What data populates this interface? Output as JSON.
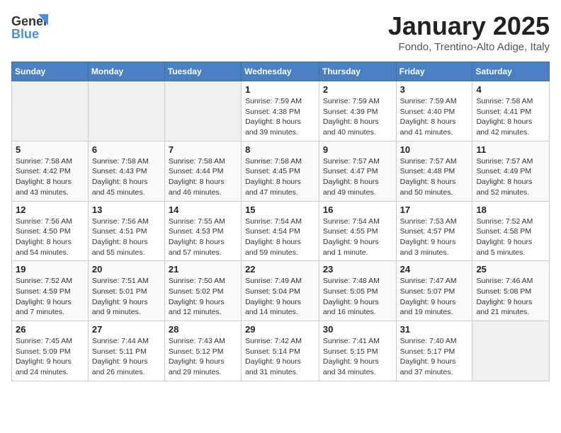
{
  "header": {
    "logo": {
      "line1": "General",
      "line2": "Blue"
    },
    "title": "January 2025",
    "subtitle": "Fondo, Trentino-Alto Adige, Italy"
  },
  "days": [
    "Sunday",
    "Monday",
    "Tuesday",
    "Wednesday",
    "Thursday",
    "Friday",
    "Saturday"
  ],
  "weeks": [
    [
      {
        "date": "",
        "sunrise": "",
        "sunset": "",
        "daylight": ""
      },
      {
        "date": "",
        "sunrise": "",
        "sunset": "",
        "daylight": ""
      },
      {
        "date": "",
        "sunrise": "",
        "sunset": "",
        "daylight": ""
      },
      {
        "date": "1",
        "sunrise": "Sunrise: 7:59 AM",
        "sunset": "Sunset: 4:38 PM",
        "daylight": "Daylight: 8 hours and 39 minutes."
      },
      {
        "date": "2",
        "sunrise": "Sunrise: 7:59 AM",
        "sunset": "Sunset: 4:39 PM",
        "daylight": "Daylight: 8 hours and 40 minutes."
      },
      {
        "date": "3",
        "sunrise": "Sunrise: 7:59 AM",
        "sunset": "Sunset: 4:40 PM",
        "daylight": "Daylight: 8 hours and 41 minutes."
      },
      {
        "date": "4",
        "sunrise": "Sunrise: 7:58 AM",
        "sunset": "Sunset: 4:41 PM",
        "daylight": "Daylight: 8 hours and 42 minutes."
      }
    ],
    [
      {
        "date": "5",
        "sunrise": "Sunrise: 7:58 AM",
        "sunset": "Sunset: 4:42 PM",
        "daylight": "Daylight: 8 hours and 43 minutes."
      },
      {
        "date": "6",
        "sunrise": "Sunrise: 7:58 AM",
        "sunset": "Sunset: 4:43 PM",
        "daylight": "Daylight: 8 hours and 45 minutes."
      },
      {
        "date": "7",
        "sunrise": "Sunrise: 7:58 AM",
        "sunset": "Sunset: 4:44 PM",
        "daylight": "Daylight: 8 hours and 46 minutes."
      },
      {
        "date": "8",
        "sunrise": "Sunrise: 7:58 AM",
        "sunset": "Sunset: 4:45 PM",
        "daylight": "Daylight: 8 hours and 47 minutes."
      },
      {
        "date": "9",
        "sunrise": "Sunrise: 7:57 AM",
        "sunset": "Sunset: 4:47 PM",
        "daylight": "Daylight: 8 hours and 49 minutes."
      },
      {
        "date": "10",
        "sunrise": "Sunrise: 7:57 AM",
        "sunset": "Sunset: 4:48 PM",
        "daylight": "Daylight: 8 hours and 50 minutes."
      },
      {
        "date": "11",
        "sunrise": "Sunrise: 7:57 AM",
        "sunset": "Sunset: 4:49 PM",
        "daylight": "Daylight: 8 hours and 52 minutes."
      }
    ],
    [
      {
        "date": "12",
        "sunrise": "Sunrise: 7:56 AM",
        "sunset": "Sunset: 4:50 PM",
        "daylight": "Daylight: 8 hours and 54 minutes."
      },
      {
        "date": "13",
        "sunrise": "Sunrise: 7:56 AM",
        "sunset": "Sunset: 4:51 PM",
        "daylight": "Daylight: 8 hours and 55 minutes."
      },
      {
        "date": "14",
        "sunrise": "Sunrise: 7:55 AM",
        "sunset": "Sunset: 4:53 PM",
        "daylight": "Daylight: 8 hours and 57 minutes."
      },
      {
        "date": "15",
        "sunrise": "Sunrise: 7:54 AM",
        "sunset": "Sunset: 4:54 PM",
        "daylight": "Daylight: 8 hours and 59 minutes."
      },
      {
        "date": "16",
        "sunrise": "Sunrise: 7:54 AM",
        "sunset": "Sunset: 4:55 PM",
        "daylight": "Daylight: 9 hours and 1 minute."
      },
      {
        "date": "17",
        "sunrise": "Sunrise: 7:53 AM",
        "sunset": "Sunset: 4:57 PM",
        "daylight": "Daylight: 9 hours and 3 minutes."
      },
      {
        "date": "18",
        "sunrise": "Sunrise: 7:52 AM",
        "sunset": "Sunset: 4:58 PM",
        "daylight": "Daylight: 9 hours and 5 minutes."
      }
    ],
    [
      {
        "date": "19",
        "sunrise": "Sunrise: 7:52 AM",
        "sunset": "Sunset: 4:59 PM",
        "daylight": "Daylight: 9 hours and 7 minutes."
      },
      {
        "date": "20",
        "sunrise": "Sunrise: 7:51 AM",
        "sunset": "Sunset: 5:01 PM",
        "daylight": "Daylight: 9 hours and 9 minutes."
      },
      {
        "date": "21",
        "sunrise": "Sunrise: 7:50 AM",
        "sunset": "Sunset: 5:02 PM",
        "daylight": "Daylight: 9 hours and 12 minutes."
      },
      {
        "date": "22",
        "sunrise": "Sunrise: 7:49 AM",
        "sunset": "Sunset: 5:04 PM",
        "daylight": "Daylight: 9 hours and 14 minutes."
      },
      {
        "date": "23",
        "sunrise": "Sunrise: 7:48 AM",
        "sunset": "Sunset: 5:05 PM",
        "daylight": "Daylight: 9 hours and 16 minutes."
      },
      {
        "date": "24",
        "sunrise": "Sunrise: 7:47 AM",
        "sunset": "Sunset: 5:07 PM",
        "daylight": "Daylight: 9 hours and 19 minutes."
      },
      {
        "date": "25",
        "sunrise": "Sunrise: 7:46 AM",
        "sunset": "Sunset: 5:08 PM",
        "daylight": "Daylight: 9 hours and 21 minutes."
      }
    ],
    [
      {
        "date": "26",
        "sunrise": "Sunrise: 7:45 AM",
        "sunset": "Sunset: 5:09 PM",
        "daylight": "Daylight: 9 hours and 24 minutes."
      },
      {
        "date": "27",
        "sunrise": "Sunrise: 7:44 AM",
        "sunset": "Sunset: 5:11 PM",
        "daylight": "Daylight: 9 hours and 26 minutes."
      },
      {
        "date": "28",
        "sunrise": "Sunrise: 7:43 AM",
        "sunset": "Sunset: 5:12 PM",
        "daylight": "Daylight: 9 hours and 29 minutes."
      },
      {
        "date": "29",
        "sunrise": "Sunrise: 7:42 AM",
        "sunset": "Sunset: 5:14 PM",
        "daylight": "Daylight: 9 hours and 31 minutes."
      },
      {
        "date": "30",
        "sunrise": "Sunrise: 7:41 AM",
        "sunset": "Sunset: 5:15 PM",
        "daylight": "Daylight: 9 hours and 34 minutes."
      },
      {
        "date": "31",
        "sunrise": "Sunrise: 7:40 AM",
        "sunset": "Sunset: 5:17 PM",
        "daylight": "Daylight: 9 hours and 37 minutes."
      },
      {
        "date": "",
        "sunrise": "",
        "sunset": "",
        "daylight": ""
      }
    ]
  ]
}
